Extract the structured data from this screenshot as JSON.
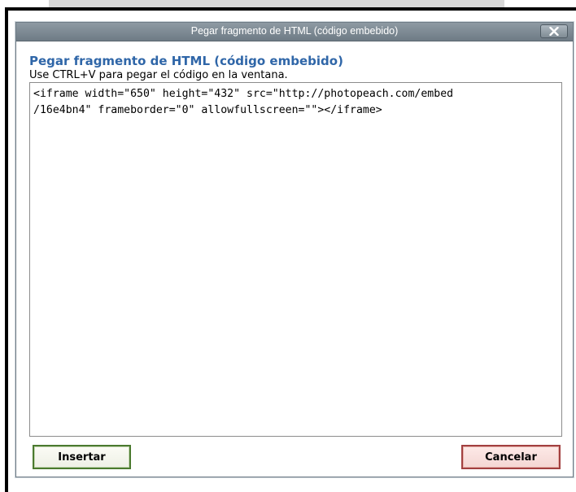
{
  "dialog": {
    "title": "Pegar fragmento de HTML (código embebido)",
    "heading": "Pegar fragmento de HTML (código embebido)",
    "instruction": "Use CTRL+V para pegar el código en la ventana.",
    "code_value": "<iframe width=\"650\" height=\"432\" src=\"http://photopeach.com/embed\n/16e4bn4\" frameborder=\"0\" allowfullscreen=\"\"></iframe>",
    "insert_label": "Insertar",
    "cancel_label": "Cancelar",
    "close_icon": "close-icon"
  },
  "colors": {
    "titlebar": "#7d8a93",
    "heading": "#2f66a8",
    "insert_border": "#4b7a2f",
    "cancel_border": "#a24040"
  }
}
